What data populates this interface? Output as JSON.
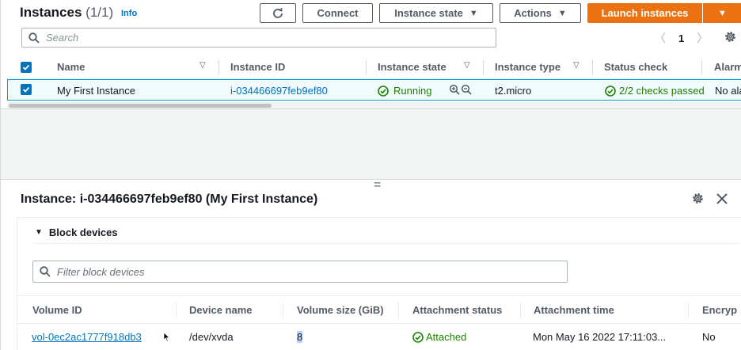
{
  "instances_panel": {
    "title": "Instances",
    "count": "(1/1)",
    "info_label": "Info",
    "buttons": {
      "connect": "Connect",
      "instance_state": "Instance state",
      "actions": "Actions",
      "launch": "Launch instances"
    },
    "search_placeholder": "Search",
    "page_number": "1",
    "columns": [
      "Name",
      "Instance ID",
      "Instance state",
      "Instance type",
      "Status check",
      "Alarm"
    ],
    "row": {
      "name": "My First Instance",
      "instance_id": "i-034466697feb9ef80",
      "state": "Running",
      "type": "t2.micro",
      "status_check": "2/2 checks passed",
      "alarm": "No ala"
    }
  },
  "detail_panel": {
    "title": "Instance: i-034466697feb9ef80 (My First Instance)",
    "section_label": "Block devices",
    "filter_placeholder": "Filter block devices",
    "columns": [
      "Volume ID",
      "Device name",
      "Volume size (GiB)",
      "Attachment status",
      "Attachment time",
      "Encryp"
    ],
    "row": {
      "volume_id": "vol-0ec2ac1777f918db3",
      "device_name": "/dev/xvda",
      "size": "8",
      "attachment_status": "Attached",
      "attachment_time": "Mon May 16 2022 17:11:03...",
      "encrypted": "No"
    }
  },
  "colors": {
    "accent": "#0073bb",
    "launch": "#ec7211",
    "success": "#1d8102"
  }
}
